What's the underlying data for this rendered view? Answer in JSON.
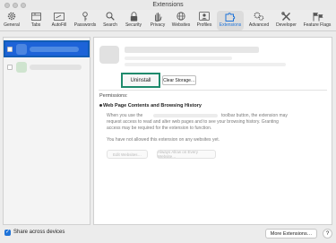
{
  "window": {
    "title": "Extensions"
  },
  "toolbar": {
    "items": [
      {
        "label": "General",
        "icon": "gear-icon"
      },
      {
        "label": "Tabs",
        "icon": "tabs-icon"
      },
      {
        "label": "AutoFill",
        "icon": "autofill-icon"
      },
      {
        "label": "Passwords",
        "icon": "key-icon"
      },
      {
        "label": "Search",
        "icon": "search-icon"
      },
      {
        "label": "Security",
        "icon": "lock-icon"
      },
      {
        "label": "Privacy",
        "icon": "hand-icon"
      },
      {
        "label": "Websites",
        "icon": "globe-icon"
      },
      {
        "label": "Profiles",
        "icon": "person-icon"
      },
      {
        "label": "Extensions",
        "icon": "puzzle-icon"
      },
      {
        "label": "Advanced",
        "icon": "gears-icon"
      },
      {
        "label": "Developer",
        "icon": "tools-icon"
      },
      {
        "label": "Feature Flags",
        "icon": "flags-icon"
      }
    ],
    "active": "Extensions",
    "accent": "#1f73d8"
  },
  "details": {
    "uninstall_label": "Uninstall",
    "clear_storage_label": "Clear Storage…",
    "permissions_title": "Permissions:",
    "permission_heading": "Web Page Contents and Browsing History",
    "perm_line1_a": "When you use the",
    "perm_line1_b": "toolbar button, the extension may",
    "perm_line2": "request access to read and alter web pages and to see your browsing history. Granting",
    "perm_line3": "access may be required for the extension to function.",
    "perm_line4": "You have not allowed this extension on any websites yet.",
    "edit_websites_label": "Edit Websites…",
    "always_allow_label": "Always Allow on Every Website…"
  },
  "footer": {
    "share_label": "Share across devices",
    "share_checked": true,
    "more_extensions_label": "More Extensions…",
    "help_label": "?"
  }
}
